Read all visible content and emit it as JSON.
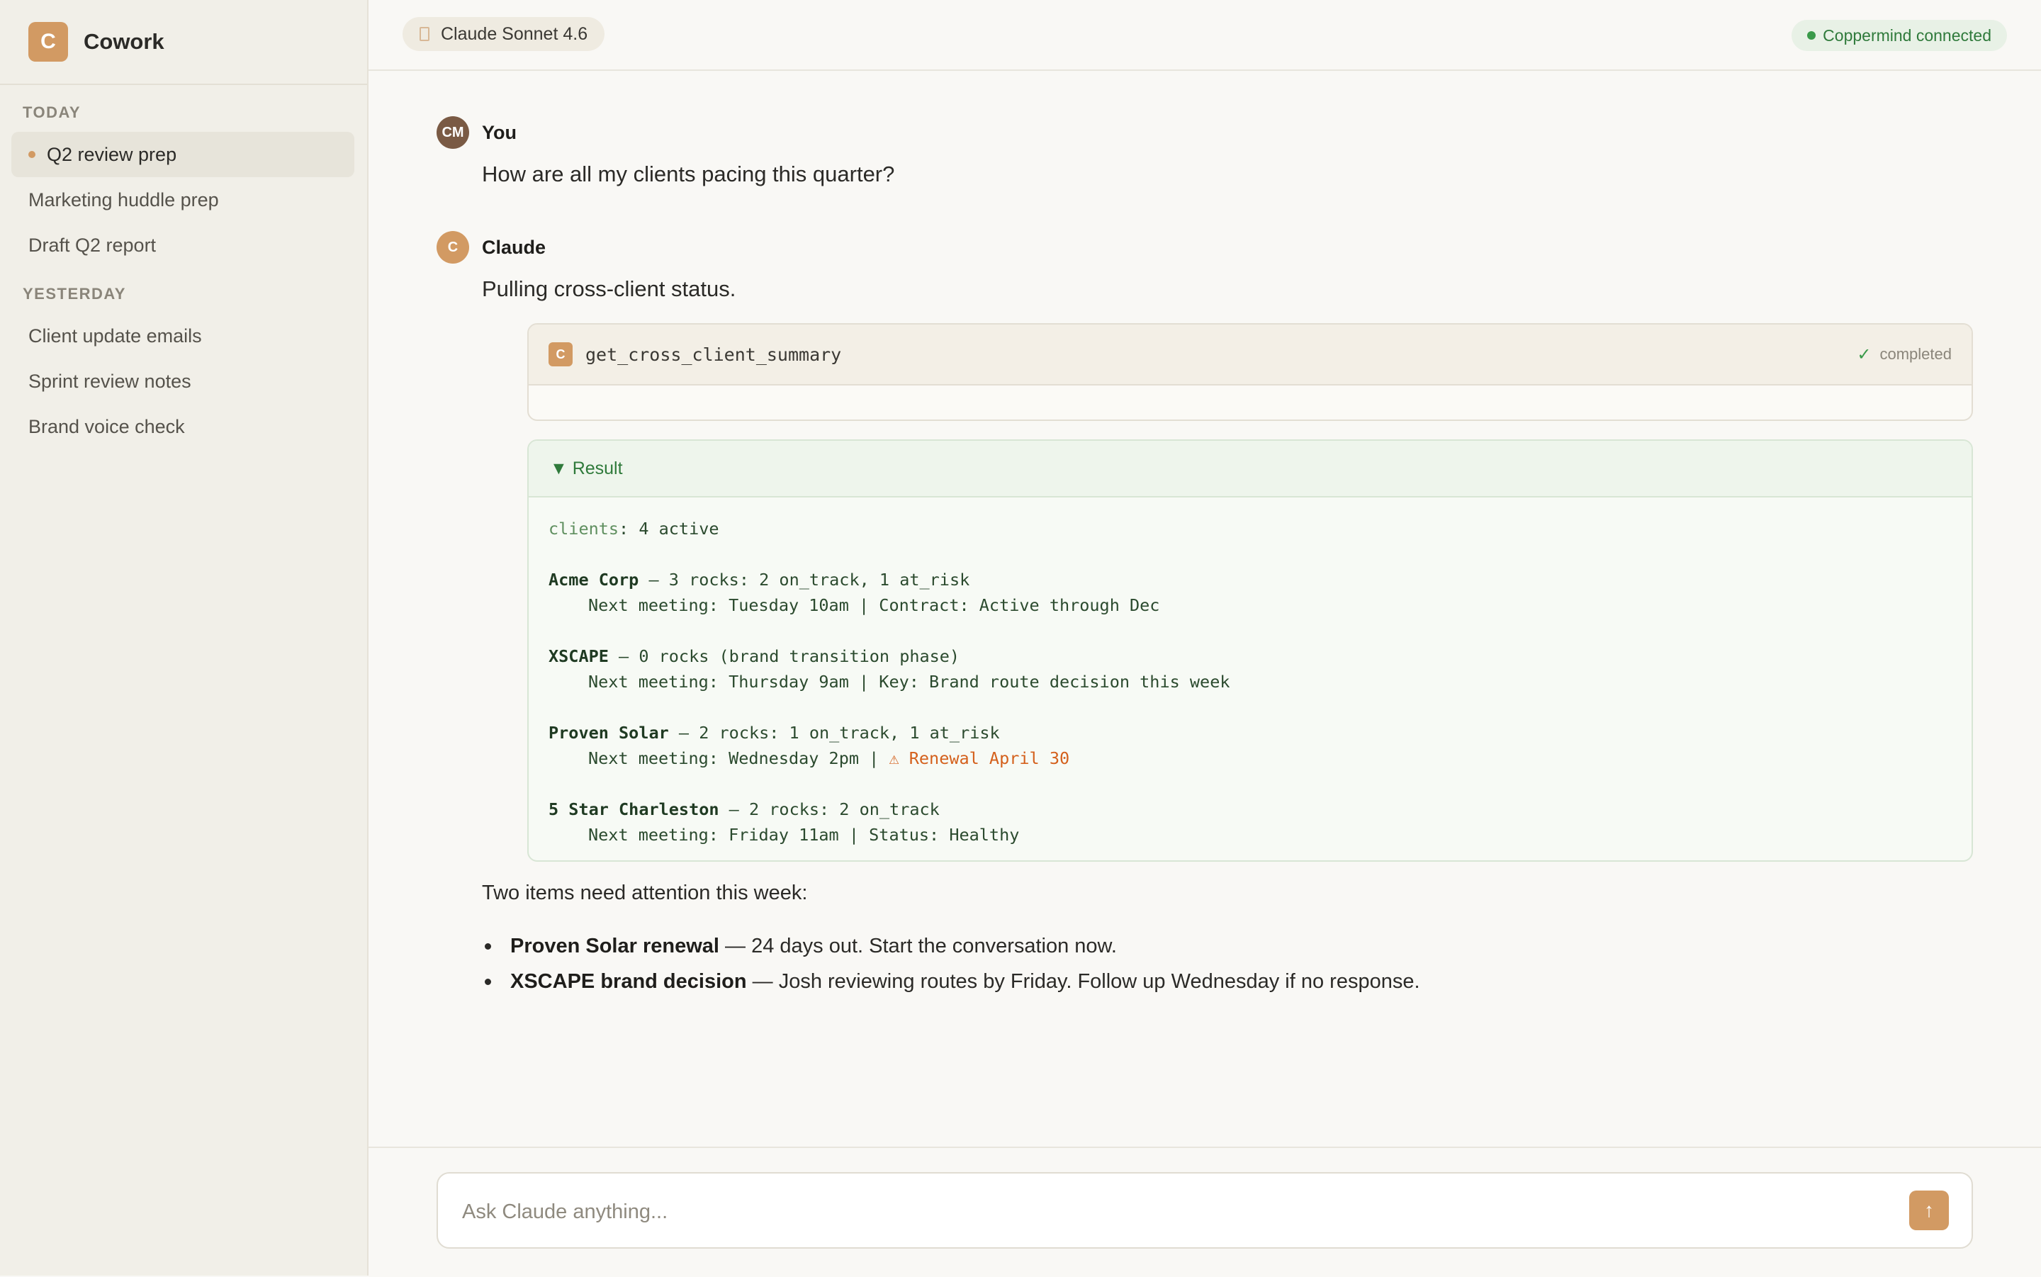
{
  "app": {
    "logo_letter": "C",
    "name": "Cowork"
  },
  "sidebar": {
    "today_label": "TODAY",
    "today_items": [
      {
        "label": "Q2 review prep"
      },
      {
        "label": "Marketing huddle prep"
      },
      {
        "label": "Draft Q2 report"
      }
    ],
    "yesterday_label": "YESTERDAY",
    "yesterday_items": [
      {
        "label": "Client update emails"
      },
      {
        "label": "Sprint review notes"
      },
      {
        "label": "Brand voice check"
      }
    ]
  },
  "header": {
    "model": "Claude Sonnet 4.6",
    "connection": "Coppermind connected"
  },
  "conversation": {
    "user": {
      "initials": "CM",
      "name": "You",
      "message": "How are all my clients pacing this quarter?"
    },
    "assistant": {
      "initial": "C",
      "name": "Claude",
      "intro": "Pulling cross-client status.",
      "tool": {
        "icon_letter": "C",
        "name": "get_cross_client_summary",
        "status": "completed"
      },
      "result": {
        "toggle": "▼ Result",
        "clients_key": "clients",
        "clients_value": ": 4 active",
        "entries": [
          {
            "name": "Acme Corp",
            "summary": " — 3 rocks: 2 on_track, 1 at_risk",
            "detail": "Next meeting: Tuesday 10am | Contract: Active through Dec",
            "warning": ""
          },
          {
            "name": "XSCAPE",
            "summary": " — 0 rocks (brand transition phase)",
            "detail": "Next meeting: Thursday 9am | Key: Brand route decision this week",
            "warning": ""
          },
          {
            "name": "Proven Solar",
            "summary": " — 2 rocks: 1 on_track, 1 at_risk",
            "detail": "Next meeting: Wednesday 2pm | ",
            "warning": "⚠ Renewal April 30"
          },
          {
            "name": "5 Star Charleston",
            "summary": " — 2 rocks: 2 on_track",
            "detail": "Next meeting: Friday 11am | Status: Healthy",
            "warning": ""
          }
        ]
      },
      "followup": "Two items need attention this week:",
      "bullets": [
        {
          "bold": "Proven Solar renewal",
          "text": " — 24 days out. Start the conversation now."
        },
        {
          "bold": "XSCAPE brand decision",
          "text": " — Josh reviewing routes by Friday. Follow up Wednesday if no response."
        }
      ]
    }
  },
  "composer": {
    "placeholder": "Ask Claude anything...",
    "send_icon": "arrow-up-icon"
  },
  "colors": {
    "accent": "#d29a63",
    "success": "#3a9a4a",
    "warning": "#d4601c"
  }
}
